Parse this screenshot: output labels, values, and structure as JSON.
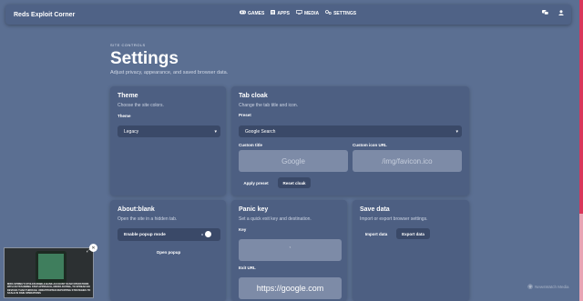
{
  "app": {
    "brand": "Reds Exploit Corner"
  },
  "nav": {
    "links": [
      {
        "label": "GAMES",
        "icon": "gamepad-icon"
      },
      {
        "label": "APPS",
        "icon": "apps-icon"
      },
      {
        "label": "MEDIA",
        "icon": "monitor-icon"
      },
      {
        "label": "SETTINGS",
        "icon": "gears-icon"
      }
    ],
    "right_icons": [
      "chat-icon",
      "user-icon"
    ]
  },
  "header": {
    "kicker": "SITE CONTROLS",
    "title": "Settings",
    "subtitle": "Adjust privacy, appearance, and saved browser data."
  },
  "theme": {
    "title": "Theme",
    "desc": "Choose the site colors.",
    "label": "Theme",
    "selected": "Legacy"
  },
  "tab_cloak": {
    "title": "Tab cloak",
    "desc": "Change the tab title and icon.",
    "preset_label": "Preset",
    "preset_selected": "Google Search",
    "custom_title_label": "Custom title",
    "custom_title_placeholder": "Google",
    "custom_icon_label": "Custom icon URL",
    "custom_icon_placeholder": "/img/favicon.ico",
    "apply_label": "Apply preset",
    "reset_label": "Reset cloak"
  },
  "about_blank": {
    "title": "About:blank",
    "desc": "Open the site in a hidden tab.",
    "toggle_label": "Enable popup mode",
    "toggle_on": false,
    "open_label": "Open popup"
  },
  "panic": {
    "title": "Panic key",
    "desc": "Set a quick exit key and destination.",
    "key_label": "Key",
    "key_value": "`",
    "url_label": "Exit URL",
    "url_value": "https://google.com"
  },
  "save_data": {
    "title": "Save data",
    "desc": "Import or export browser settings.",
    "import_label": "Import data",
    "export_label": "Export data"
  },
  "video": {
    "caption": "MIRA SPRING'S STOLEN MOBILE BANK ACCOUNT SCAM OPERATIONS WITH OUTSTANDING STEP APPROACH, MICRO-DATING, TO SPREAD EN DEVICES THAN THROUGH UNSUPPORTED REPORTING STRATEGIES TO SCALE IN RAIN OPERATIONS"
  },
  "watermark": {
    "text": "NewsWatch Media"
  },
  "colors": {
    "background": "#5b6f92",
    "card": "#4d5f82",
    "control": "#3a4968",
    "field": "#7d8ba7",
    "scrollbar": "#d9365a"
  }
}
